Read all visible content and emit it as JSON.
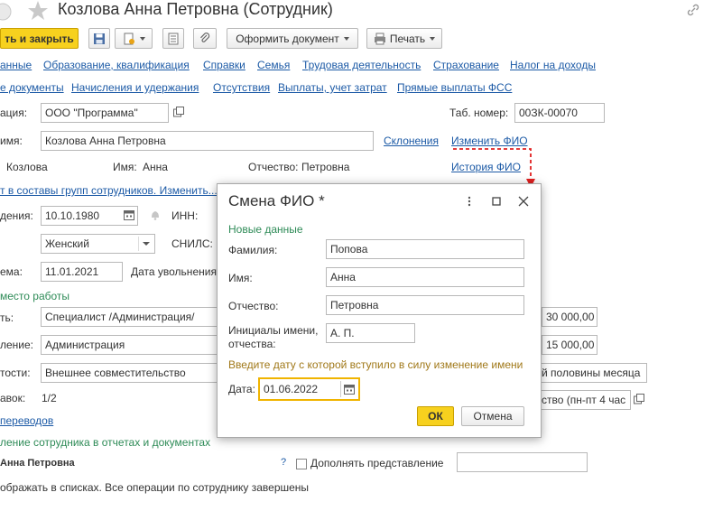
{
  "window": {
    "title": "Козлова Анна Петровна (Сотрудник)"
  },
  "toolbar": {
    "save_close_label": "ть и закрыть",
    "create_doc_label": "Оформить документ",
    "print_label": "Печать"
  },
  "nav_row1": [
    "анные",
    "Образование, квалификация",
    "Справки",
    "Семья",
    "Трудовая деятельность",
    "Страхование",
    "Налог на доходы"
  ],
  "nav_row2": [
    "е документы",
    "Начисления и удержания",
    "Отсутствия",
    "Выплаты, учет затрат",
    "Прямые выплаты ФСС"
  ],
  "form": {
    "org_label": "ация:",
    "org_value": "ООО \"Программа\"",
    "tab_num_label": "Таб. номер:",
    "tab_num_value": "00ЗК-00070",
    "name_label": "имя:",
    "name_value": "Козлова Анна Петровна",
    "declension_link": "Склонения",
    "change_fio_link": "Изменить ФИО",
    "surname_value": "Козлова",
    "first_label": "Имя:",
    "first_value": "Анна",
    "patronymic_label": "Отчество:",
    "patronymic_value": "Петровна",
    "history_link": "История ФИО",
    "groups_link": "т в составы групп сотрудников. Изменить...",
    "birth_label": "дения:",
    "birth_value": "10.10.1980",
    "inn_label": "ИНН:",
    "gender_value": "Женский",
    "snils_label": "СНИЛС:",
    "hire_label": "ема:",
    "hire_value": "11.01.2021",
    "dismiss_label": "Дата увольнения",
    "workplace_header": "место работы",
    "position_label": "ть:",
    "position_value": "Специалист /Администрация/",
    "salary1": "30 000,00",
    "dept_label": "ление:",
    "dept_value": "Администрация",
    "salary2": "15 000,00",
    "kind_label": "тости:",
    "kind_value": "Внешнее совместительство",
    "advance_value": "й половины месяца",
    "rates_label": "авок:",
    "rates_value": "1/2",
    "schedule_value": "ство (пн-пт 4 час",
    "transfers_link": "переводов",
    "repr_header": "ление сотрудника в отчетах и документах",
    "repr_name": "Анна Петровна",
    "help_mark": "?",
    "extend_label": "Дополнять представление",
    "footer_note": "ображать в списках. Все операции по сотруднику завершены"
  },
  "dialog": {
    "title": "Смена ФИО *",
    "section_new": "Новые данные",
    "surname_label": "Фамилия:",
    "surname_value": "Попова",
    "first_label": "Имя:",
    "first_value": "Анна",
    "patronymic_label": "Отчество:",
    "patronymic_value": "Петровна",
    "initials_label_1": "Инициалы имени,",
    "initials_label_2": "отчества:",
    "initials_value": "А. П.",
    "hint": "Введите дату с которой вступило в силу изменение имени",
    "date_label": "Дата:",
    "date_value": "01.06.2022",
    "ok_label": "ОК",
    "cancel_label": "Отмена"
  },
  "colors": {
    "accent_yellow": "#f7d11e",
    "link_blue": "#1c5aa6",
    "section_green": "#2e8b57",
    "arrow_red": "#e02020"
  }
}
